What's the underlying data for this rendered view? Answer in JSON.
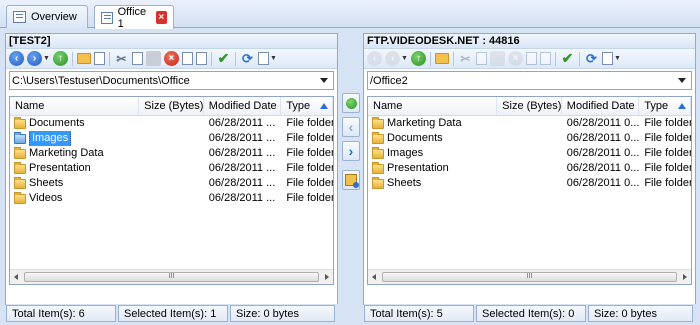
{
  "tabs": [
    {
      "label": "Overview",
      "icon": "window-icon",
      "active": false
    },
    {
      "label": "Office 1",
      "icon": "transfer-icon",
      "active": true,
      "close": "×"
    }
  ],
  "left": {
    "title": "[TEST2]",
    "path": "C:\\Users\\Testuser\\Documents\\Office",
    "columns": [
      "Name",
      "Size (Bytes)",
      "Modified Date",
      "Type"
    ],
    "rows": [
      {
        "name": "Documents",
        "size": "",
        "date": "06/28/2011 ...",
        "type": "File folder",
        "selected": false
      },
      {
        "name": "Images",
        "size": "",
        "date": "06/28/2011 ...",
        "type": "File folder",
        "selected": true
      },
      {
        "name": "Marketing Data",
        "size": "",
        "date": "06/28/2011 ...",
        "type": "File folder",
        "selected": false
      },
      {
        "name": "Presentation",
        "size": "",
        "date": "06/28/2011 ...",
        "type": "File folder",
        "selected": false
      },
      {
        "name": "Sheets",
        "size": "",
        "date": "06/28/2011 ...",
        "type": "File folder",
        "selected": false
      },
      {
        "name": "Videos",
        "size": "",
        "date": "06/28/2011 ...",
        "type": "File folder",
        "selected": false
      }
    ],
    "status": {
      "total": "Total Item(s): 6",
      "selected": "Selected Item(s): 1",
      "size": "Size: 0 bytes"
    }
  },
  "right": {
    "title": "FTP.VIDEODESK.NET : 44816",
    "path": "/Office2",
    "columns": [
      "Name",
      "Size (Bytes)",
      "Modified Date",
      "Type"
    ],
    "rows": [
      {
        "name": "Marketing Data",
        "size": "",
        "date": "06/28/2011 0...",
        "type": "File folder"
      },
      {
        "name": "Documents",
        "size": "",
        "date": "06/28/2011 0...",
        "type": "File folder"
      },
      {
        "name": "Images",
        "size": "",
        "date": "06/28/2011 0...",
        "type": "File folder"
      },
      {
        "name": "Presentation",
        "size": "",
        "date": "06/28/2011 0...",
        "type": "File folder"
      },
      {
        "name": "Sheets",
        "size": "",
        "date": "06/28/2011 0...",
        "type": "File folder"
      }
    ],
    "status": {
      "total": "Total Item(s): 5",
      "selected": "Selected Item(s): 0",
      "size": "Size: 0 bytes"
    }
  },
  "scroll_grip": "III",
  "colors": {
    "selection": "#3399ff",
    "frame": "#d6e3f5",
    "sort_arrow": "#2d6fd0"
  }
}
